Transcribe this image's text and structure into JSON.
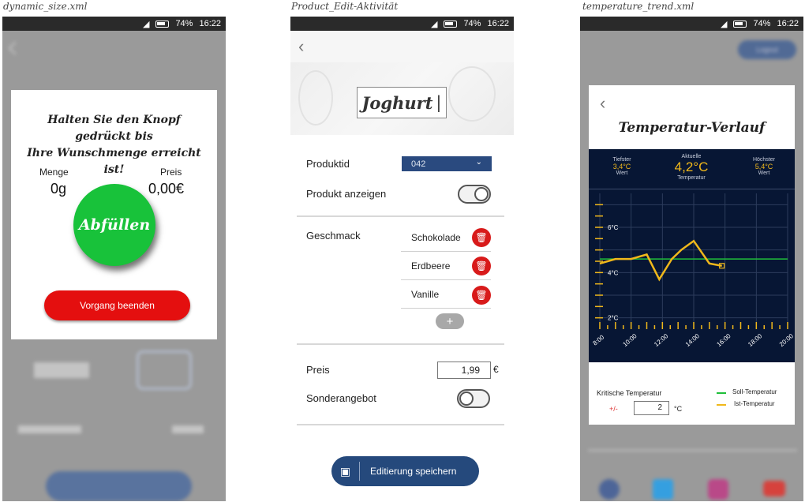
{
  "captions": {
    "left": "dynamic_size.xml",
    "middle": "Product_Edit-Aktivität",
    "right": "temperature_trend.xml"
  },
  "status_bar": {
    "battery": "74%",
    "time": "16:22"
  },
  "screen1": {
    "instruction_line1": "Halten Sie den Knopf gedrückt bis",
    "instruction_line2": "Ihre Wunschmenge erreicht ist!",
    "menge_label": "Menge",
    "menge_value": "0g",
    "preis_label": "Preis",
    "preis_value": "0,00€",
    "fill_button": "Abfüllen",
    "end_button": "Vorgang beenden"
  },
  "screen2": {
    "product_name": "Joghurt",
    "produktid_label": "Produktid",
    "produktid_value": "042",
    "anzeigen_label": "Produkt anzeigen",
    "anzeigen_on": true,
    "geschmack_label": "Geschmack",
    "flavors": [
      "Schokolade",
      "Erdbeere",
      "Vanille"
    ],
    "add_label": "+",
    "preis_label": "Preis",
    "preis_value": "1,99",
    "currency": "€",
    "sonderangebot_label": "Sonderangebot",
    "sonderangebot_on": false,
    "save_button": "Editierung speichern"
  },
  "screen3": {
    "logout": "Logout",
    "title": "Temperatur-Verlauf",
    "min": {
      "top": "Tiefster",
      "value": "3,4°C",
      "bottom": "Wert"
    },
    "current": {
      "top": "Aktuelle",
      "value": "4,2°C",
      "bottom": "Temperatur"
    },
    "max": {
      "top": "Höchster",
      "value": "5,4°C",
      "bottom": "Wert"
    },
    "critical_label": "Kritische Temperatur",
    "tolerance_sign": "+/-",
    "tolerance_value": "2",
    "tolerance_unit": "°C",
    "legend_soll": "Soll-Temperatur",
    "legend_ist": "Ist-Temperatur",
    "colors": {
      "soll": "#1fbf3a",
      "ist": "#f0b81b",
      "panel": "#071634"
    }
  },
  "chart_data": {
    "type": "line",
    "title": "Temperatur-Verlauf",
    "x_ticks": [
      "8:00",
      "10:00",
      "12:00",
      "14:00",
      "16:00",
      "18:00",
      "20:00"
    ],
    "y_ticks": [
      "2°C",
      "4°C",
      "6°C"
    ],
    "x": [
      8,
      9,
      10,
      11,
      11.8,
      12.6,
      13.2,
      14,
      15,
      15.8
    ],
    "series": [
      {
        "values": [
          4.4,
          4.6,
          4.6,
          4.8,
          3.7,
          4.6,
          5.0,
          5.4,
          4.4,
          4.3
        ]
      }
    ],
    "reference_line": 4.6,
    "xlim": [
      8,
      20
    ],
    "ylim": [
      1.5,
      7.5
    ],
    "grid": true
  }
}
